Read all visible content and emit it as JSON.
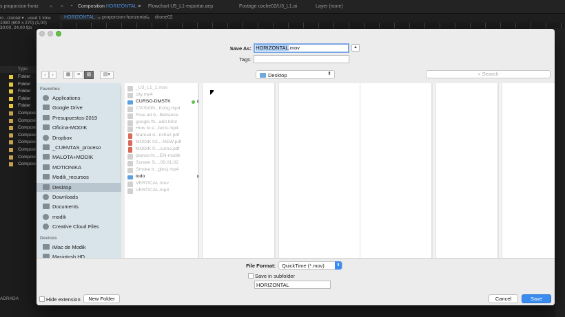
{
  "ae": {
    "tabs": [
      "s proporcion-horiz",
      "Composition",
      "HORIZONTAL",
      "Flowchart U5_L1-exportar.aep",
      "Footage coche02/U3_L1.ai",
      "Layer (none)"
    ],
    "subtabs": [
      "HORIZONTAL",
      "proporcion-horizontal",
      "drone02"
    ],
    "info_lines": [
      "rc...izontal ▾ , used 1 time",
      "1080 (600 x 270) (1,00)",
      "30:00, 24,00 fps"
    ],
    "project_header": "Type",
    "project_rows": [
      {
        "type": "Folder",
        "color": "#e8c640"
      },
      {
        "type": "Folder",
        "color": "#e8c640"
      },
      {
        "type": "Folder",
        "color": "#e8c640"
      },
      {
        "type": "Folder",
        "color": "#e8c640"
      },
      {
        "type": "Folder",
        "color": "#e8c640"
      },
      {
        "type": "Composi",
        "color": "#c8a050"
      },
      {
        "type": "Composi",
        "color": "#c8a050"
      },
      {
        "type": "Composi",
        "color": "#c8a050"
      },
      {
        "type": "Composi",
        "color": "#c8a050"
      },
      {
        "type": "Composi",
        "color": "#c8a050"
      },
      {
        "type": "Composi",
        "color": "#c8a050"
      },
      {
        "type": "Composi",
        "color": "#c8a050"
      },
      {
        "type": "Composi",
        "color": "#c8a050"
      }
    ],
    "bottom_label": "ADRADA"
  },
  "dialog": {
    "save_as_label": "Save As:",
    "save_as_selected": "HORIZONTAL",
    "save_as_rest": ".mov",
    "tags_label": "Tags:",
    "tags_value": "",
    "location": "Desktop",
    "search_placeholder": "Search",
    "sidebar": {
      "favorites_header": "Favorites",
      "favorites": [
        {
          "label": "Applications",
          "icon": "applications-icon"
        },
        {
          "label": "Google Drive",
          "icon": "folder-icon"
        },
        {
          "label": "Presupuestos-2019",
          "icon": "folder-icon"
        },
        {
          "label": "Oficina-MODIK",
          "icon": "folder-icon"
        },
        {
          "label": "Dropbox",
          "icon": "dropbox-icon"
        },
        {
          "label": "_CUENTAS_proceso",
          "icon": "folder-icon"
        },
        {
          "label": "MALOTA+MODIK",
          "icon": "folder-icon"
        },
        {
          "label": "MOTIONIKA",
          "icon": "folder-icon"
        },
        {
          "label": "Modik_recursos",
          "icon": "folder-icon"
        },
        {
          "label": "Desktop",
          "icon": "desktop-icon",
          "selected": true
        },
        {
          "label": "Downloads",
          "icon": "downloads-icon"
        },
        {
          "label": "Documents",
          "icon": "documents-icon"
        },
        {
          "label": "modik",
          "icon": "home-icon"
        },
        {
          "label": "Creative Cloud Files",
          "icon": "creative-cloud-icon"
        }
      ],
      "devices_header": "Devices",
      "devices": [
        {
          "label": "iMac de Modik",
          "icon": "imac-icon"
        },
        {
          "label": "Macintosh HD",
          "icon": "disk-icon"
        }
      ]
    },
    "files": [
      {
        "name": "_U3_L1_1.mov",
        "kind": "file"
      },
      {
        "name": "city.mp4",
        "kind": "file"
      },
      {
        "name": "CURSO-DMSTK",
        "kind": "folder",
        "tag_color": "#5ec245"
      },
      {
        "name": "CVISION...Kong.mp4",
        "kind": "file"
      },
      {
        "name": "Free ad b...Behance",
        "kind": "file"
      },
      {
        "name": "google f9...a60.html",
        "kind": "file"
      },
      {
        "name": "How to e...fects.mp4",
        "kind": "file"
      },
      {
        "name": "Manual d...nchez.pdf",
        "kind": "pdf"
      },
      {
        "name": "MODIK 02....NEW.pdf",
        "kind": "pdf"
      },
      {
        "name": "MODIK 0....curso.pdf",
        "kind": "pdf"
      },
      {
        "name": "planos-N....EN-modik",
        "kind": "file"
      },
      {
        "name": "Screen S....09.01.02",
        "kind": "file"
      },
      {
        "name": "Smoke tr...gins).mp4",
        "kind": "file"
      },
      {
        "name": "todo",
        "kind": "folder"
      },
      {
        "name": "VERTICAL.mov",
        "kind": "file"
      },
      {
        "name": "VERTICAL.mp4",
        "kind": "file"
      }
    ],
    "file_format_label": "File Format:",
    "file_format_value": "QuickTime (*.mov)",
    "save_in_subfolder_label": "Save in subfolder",
    "subfolder_value": "HORIZONTAL",
    "hide_extension_label": "Hide extension",
    "new_folder_label": "New Folder",
    "cancel_label": "Cancel",
    "save_label": "Save"
  }
}
